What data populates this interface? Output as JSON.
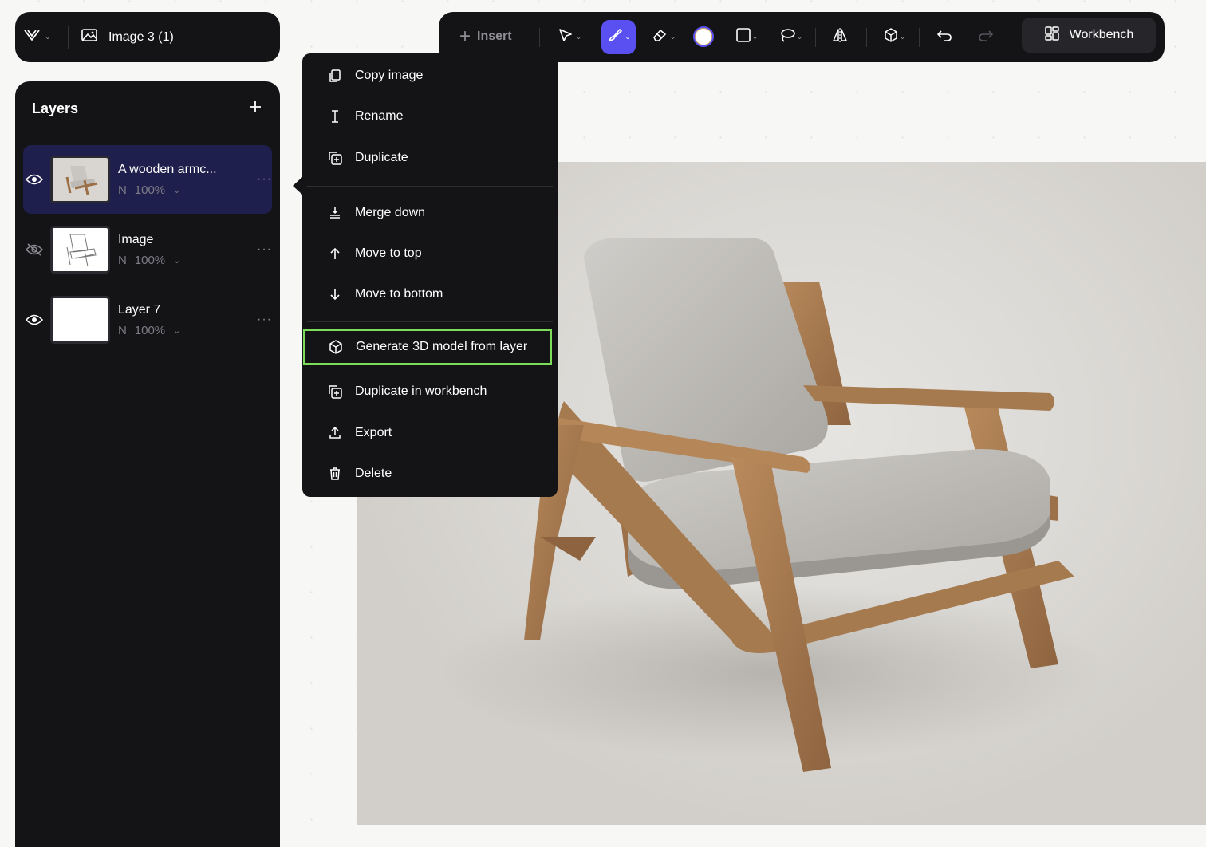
{
  "doc": {
    "title": "Image 3 (1)",
    "logo_icon": "app-logo-icon",
    "image_icon": "image-icon"
  },
  "toolbar": {
    "insert_label": "Insert",
    "workbench_label": "Workbench",
    "active_tool_color": "#5a4ff0",
    "tools": [
      "select-tool",
      "brush-tool",
      "eraser-tool",
      "color-swatch",
      "shape-tool",
      "lasso-tool",
      "flip-tool",
      "3d-tool",
      "undo",
      "redo"
    ]
  },
  "layers": {
    "title": "Layers",
    "items": [
      {
        "name": "A wooden armc...",
        "blend": "N",
        "opacity": "100%",
        "visible": true,
        "selected": true
      },
      {
        "name": "Image",
        "blend": "N",
        "opacity": "100%",
        "visible": false,
        "selected": false
      },
      {
        "name": "Layer 7",
        "blend": "N",
        "opacity": "100%",
        "visible": true,
        "selected": false
      }
    ]
  },
  "context_menu": {
    "items": [
      {
        "label": "Copy image",
        "icon": "copy-icon"
      },
      {
        "label": "Rename",
        "icon": "text-cursor-icon"
      },
      {
        "label": "Duplicate",
        "icon": "duplicate-icon"
      },
      {
        "label": "Merge down",
        "icon": "merge-down-icon"
      },
      {
        "label": "Move to top",
        "icon": "arrow-up-icon"
      },
      {
        "label": "Move to bottom",
        "icon": "arrow-down-icon"
      },
      {
        "label": "Generate 3D model from layer",
        "icon": "cube-icon",
        "highlighted": true
      },
      {
        "label": "Duplicate in workbench",
        "icon": "duplicate-workbench-icon"
      },
      {
        "label": "Export",
        "icon": "export-icon"
      },
      {
        "label": "Delete",
        "icon": "trash-icon"
      }
    ],
    "highlight_color": "#7ddc5a"
  }
}
